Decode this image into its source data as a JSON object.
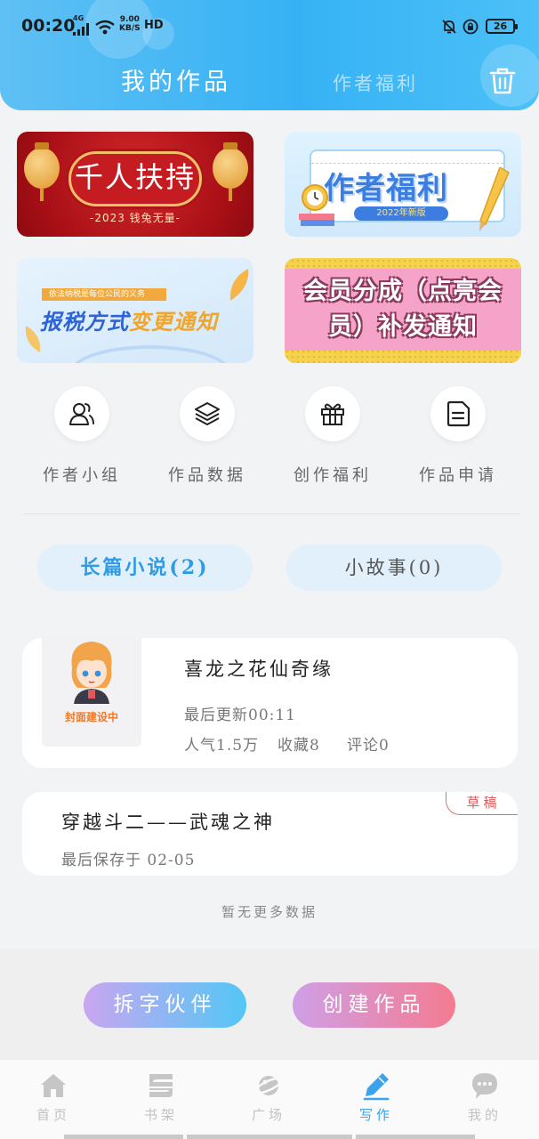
{
  "status_bar": {
    "time": "00:20",
    "network": "4G",
    "speed_value": "9.00",
    "speed_unit": "KB/S",
    "hd": "HD",
    "battery": "26"
  },
  "header": {
    "tabs": [
      {
        "label": "我的作品",
        "active": true
      },
      {
        "label": "作者福利",
        "active": false
      }
    ],
    "delete_icon": "trash-icon"
  },
  "banners": [
    {
      "title": "千人扶持",
      "subtitle": "-2023 钱兔无量-",
      "theme_color": "#b5141a"
    },
    {
      "title": "作者福利",
      "subtitle": "2022年新版",
      "theme_color": "#3e7de0"
    },
    {
      "kicker": "依法纳税是每位公民的义务",
      "title_main": "报税方式",
      "title_highlight": "变更通知",
      "theme_color": "#2e63d8"
    },
    {
      "title_line1": "会员分成（点亮会",
      "title_line2": "员）补发通知",
      "theme_color": "#f5a3c9"
    }
  ],
  "quick_entries": [
    {
      "label": "作者小组",
      "icon": "group-icon"
    },
    {
      "label": "作品数据",
      "icon": "layers-icon"
    },
    {
      "label": "创作福利",
      "icon": "gift-icon"
    },
    {
      "label": "作品申请",
      "icon": "document-icon"
    }
  ],
  "segments": {
    "long_novel": "长篇小说(2)",
    "short_story": "小故事(0)"
  },
  "works": [
    {
      "title": "喜龙之花仙奇缘",
      "cover_label": "封面建设中",
      "updated": "最后更新00:11",
      "popularity": "人气1.5万",
      "favorites": "收藏8",
      "comments": "评论0"
    },
    {
      "title": "穿越斗二——武魂之神",
      "badge": "草稿",
      "saved": "最后保存于 02-05"
    }
  ],
  "no_more_text": "暂无更多数据",
  "actions": {
    "split_partner": "拆字伙伴",
    "create_work": "创建作品"
  },
  "tabbar": [
    {
      "label": "首页",
      "icon": "home-icon",
      "active": false
    },
    {
      "label": "书架",
      "icon": "bookshelf-icon",
      "active": false
    },
    {
      "label": "广场",
      "icon": "planet-icon",
      "active": false
    },
    {
      "label": "写作",
      "icon": "pen-icon",
      "active": true
    },
    {
      "label": "我的",
      "icon": "chat-bubble-icon",
      "active": false
    }
  ],
  "colors": {
    "header_blue": "#36b2f4",
    "accent_blue": "#3aa3ec",
    "draft_red": "#e25757"
  }
}
